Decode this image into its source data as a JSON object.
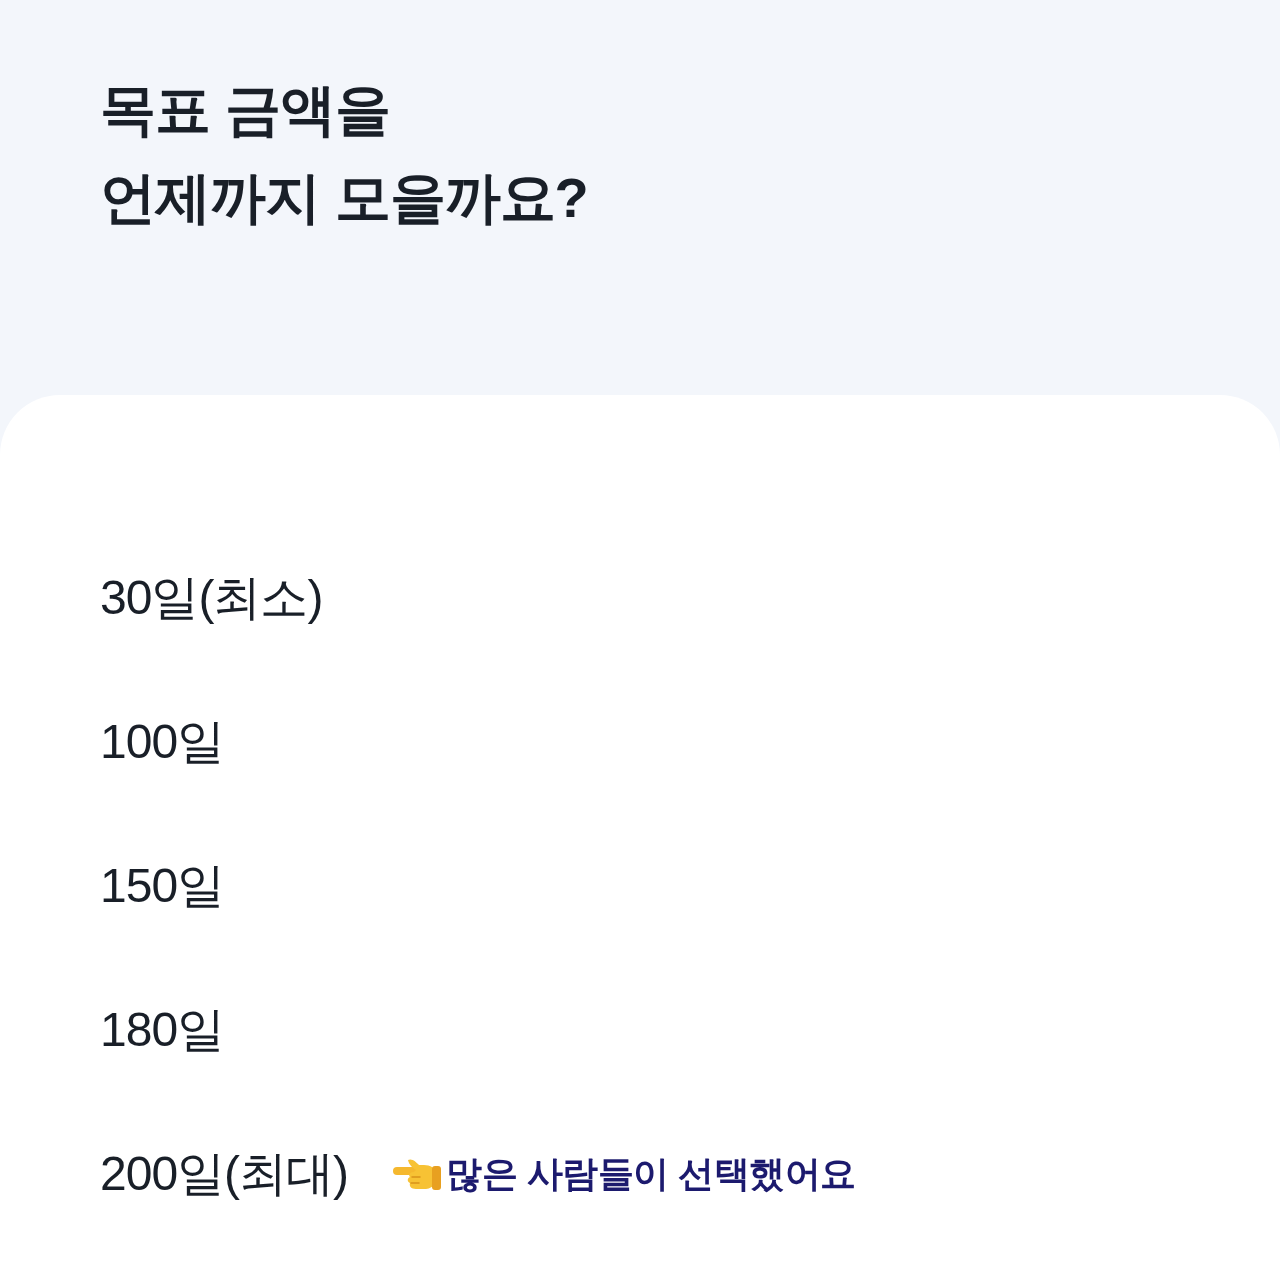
{
  "title": "목표 금액을\n언제까지 모을까요?",
  "options": [
    {
      "label": "30일(최소)"
    },
    {
      "label": "100일"
    },
    {
      "label": "150일"
    },
    {
      "label": "180일"
    },
    {
      "label": "200일(최대)",
      "note": "많은 사람들이 선택했어요"
    }
  ]
}
